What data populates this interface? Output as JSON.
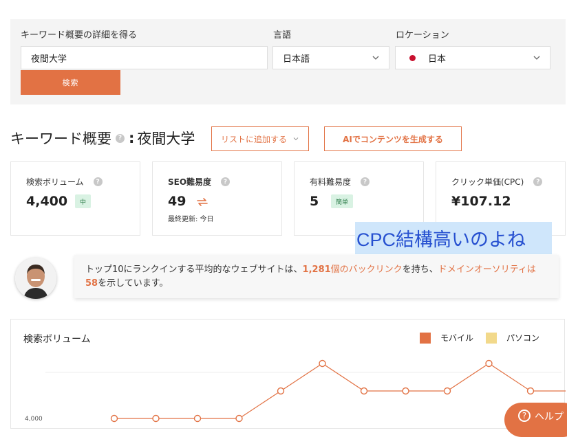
{
  "colors": {
    "accent": "#e27244",
    "panel_bg": "#f4f4f4",
    "badge_green_bg": "#d9f2e3",
    "badge_green_text": "#2e7d4b",
    "legend_desktop": "#f2d98b",
    "flag_red": "#c8102e"
  },
  "search": {
    "keyword_label": "キーワード概要の詳細を得る",
    "keyword_value": "夜間大学",
    "language_label": "言語",
    "language_value": "日本語",
    "location_label": "ロケーション",
    "location_value": "日本",
    "search_button": "検索"
  },
  "overview": {
    "title_prefix": "キーワード概要",
    "title_sep": ":",
    "title_keyword": "夜間大学",
    "add_list_button": "リストに追加する",
    "ai_button": "AIでコンテンツを生成する"
  },
  "metrics": [
    {
      "label": "検索ボリューム",
      "value": "4,400",
      "badge": "中"
    },
    {
      "label": "SEO難易度",
      "value": "49",
      "sub": "最終更新: 今日"
    },
    {
      "label": "有料難易度",
      "value": "5",
      "badge": "簡単"
    },
    {
      "label": "クリック単価(CPC)",
      "value": "¥107.12"
    }
  ],
  "annotation": "CPC結構高いのよね",
  "insight": {
    "t1": "トップ10にランクインする平均的なウェブサイトは、",
    "t2": "1,281",
    "t3": "個のバックリンク",
    "t4": "を持ち、",
    "t5": "ドメインオーソリティは",
    "t6": "58",
    "t7": "を示しています。"
  },
  "chart_data": {
    "type": "line",
    "title": "検索ボリューム",
    "legend": [
      "モバイル",
      "パソコン"
    ],
    "ytick_visible": "4,000",
    "series": [
      {
        "name": "モバイル",
        "values": [
          3400,
          3400,
          3400,
          3400,
          4400,
          5400,
          4400,
          4400,
          4400,
          5400,
          4400,
          4400,
          4400
        ]
      }
    ],
    "ylim": [
      3300,
      6000
    ],
    "grid": true,
    "legend_position": "top-right"
  },
  "help_label": "ヘルプ"
}
